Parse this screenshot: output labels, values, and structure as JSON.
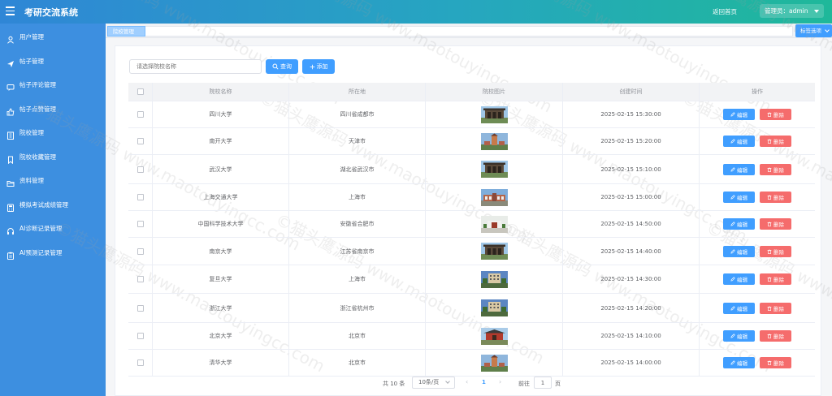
{
  "header": {
    "title": "考研交流系统",
    "back_home": "返回首页",
    "admin": "管理员：admin",
    "gradient": [
      "#2f86d6",
      "#1fb89a"
    ]
  },
  "sidebar": {
    "bg_color": "#3d8fe0",
    "items": [
      {
        "label": "用户管理",
        "icon": "user-icon"
      },
      {
        "label": "帖子管理",
        "icon": "send-icon"
      },
      {
        "label": "帖子评论管理",
        "icon": "comment-icon"
      },
      {
        "label": "帖子点赞管理",
        "icon": "thumbs-up-icon"
      },
      {
        "label": "院校管理",
        "icon": "building-icon"
      },
      {
        "label": "院校收藏管理",
        "icon": "bookmark-icon"
      },
      {
        "label": "资料管理",
        "icon": "folder-icon"
      },
      {
        "label": "模拟考试成绩管理",
        "icon": "calculator-icon"
      },
      {
        "label": "AI诊断记录管理",
        "icon": "headset-icon"
      },
      {
        "label": "AI预测记录管理",
        "icon": "clipboard-icon"
      }
    ]
  },
  "tabs": {
    "active": "院校管理",
    "options": "标签选项"
  },
  "search": {
    "placeholder": "请选择院校名称",
    "query_label": "查询",
    "add_label": "添加"
  },
  "table": {
    "headers": {
      "name": "院校名称",
      "location": "所在地",
      "image": "院校图片",
      "created": "创建时间",
      "ops": "操作"
    },
    "edit_label": "编辑",
    "delete_label": "删除",
    "rows": [
      {
        "name": "四川大学",
        "location": "四川省成都市",
        "created": "2025-02-15 15:30:00",
        "thumb": "gate"
      },
      {
        "name": "南开大学",
        "location": "天津市",
        "created": "2025-02-15 15:20:00",
        "thumb": "tower"
      },
      {
        "name": "武汉大学",
        "location": "湖北省武汉市",
        "created": "2025-02-15 15:10:00",
        "thumb": "gate"
      },
      {
        "name": "上海交通大学",
        "location": "上海市",
        "created": "2025-02-15 15:00:00",
        "thumb": "hall"
      },
      {
        "name": "中国科学技术大学",
        "location": "安徽省合肥市",
        "created": "2025-02-15 14:50:00",
        "thumb": "square"
      },
      {
        "name": "南京大学",
        "location": "江苏省南京市",
        "created": "2025-02-15 14:40:00",
        "thumb": "gate"
      },
      {
        "name": "复旦大学",
        "location": "上海市",
        "created": "2025-02-15 14:30:00",
        "thumb": "building"
      },
      {
        "name": "浙江大学",
        "location": "浙江省杭州市",
        "created": "2025-02-15 14:20:00",
        "thumb": "building"
      },
      {
        "name": "北京大学",
        "location": "北京市",
        "created": "2025-02-15 14:10:00",
        "thumb": "gate-red"
      },
      {
        "name": "清华大学",
        "location": "北京市",
        "created": "2025-02-15 14:00:00",
        "thumb": "tower"
      }
    ]
  },
  "pagination": {
    "total": "共 10 条",
    "page_size": "10条/页",
    "current_page": "1",
    "goto": "前往",
    "goto_value": "1",
    "page_suffix": "页"
  },
  "watermark": "©猫头鹰源码 www.maotouyingcc.com",
  "colors": {
    "primary": "#409eff",
    "danger": "#f56c6c"
  }
}
